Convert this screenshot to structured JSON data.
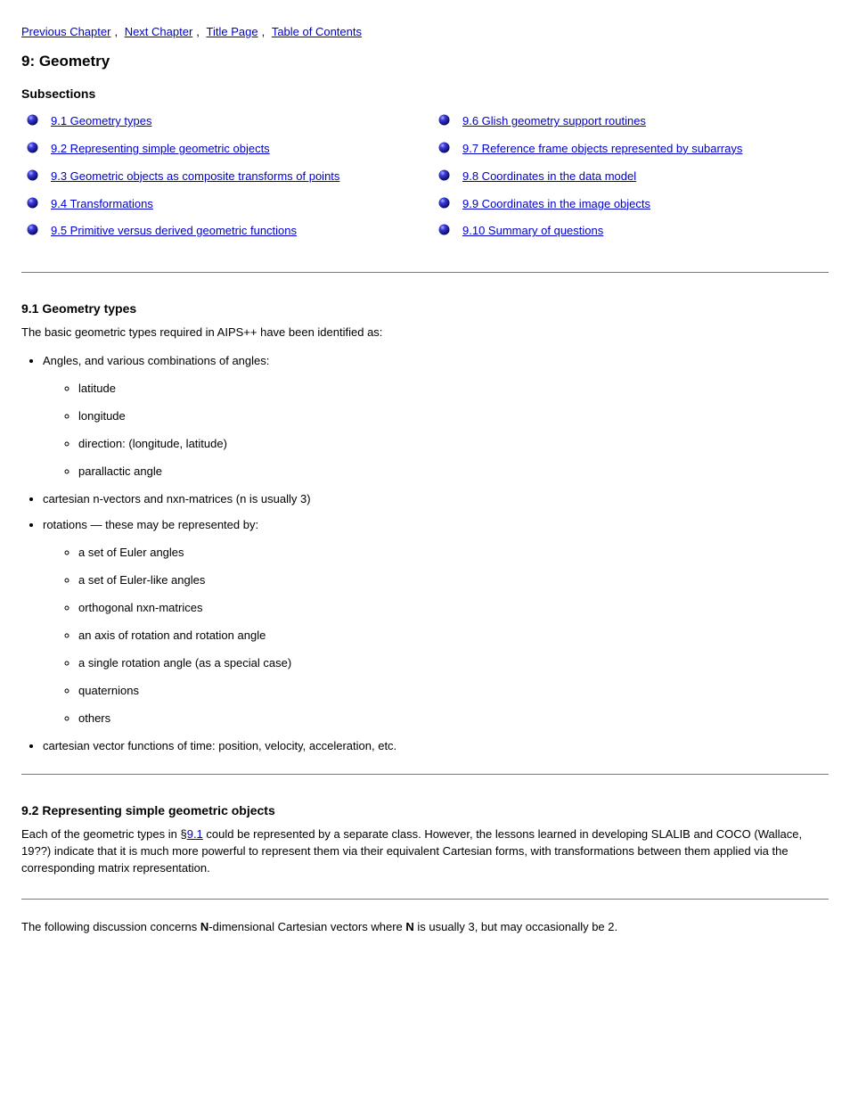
{
  "nav": {
    "prev": "Previous Chapter",
    "sep12": ", ",
    "next": "Next Chapter",
    "sep23": ", ",
    "title": "Title Page",
    "sep34": ", ",
    "toc": "Table of Contents"
  },
  "header": {
    "page_title": "9: Geometry",
    "subsections_label": "Subsections"
  },
  "toc_col1": [
    "9.1 Geometry types",
    "9.2 Representing simple geometric objects",
    "9.3 Geometric objects as composite transforms of points",
    "9.4 Transformations",
    "9.5 Primitive versus derived geometric functions"
  ],
  "toc_col2": [
    "9.6 Glish geometry support routines",
    "9.7 Reference frame objects represented by subarrays",
    "9.8 Coordinates in the data model",
    "9.9 Coordinates in the image objects",
    "9.10 Summary of questions"
  ],
  "sec91": {
    "heading": "9.1 Geometry types",
    "p1": "The basic geometric types required in AIPS++ have been identified as:",
    "bullets": [
      {
        "text": "Angles, and various combinations of angles:",
        "sub": [
          "latitude",
          "longitude",
          "direction: (longitude, latitude)",
          "parallactic angle"
        ]
      },
      {
        "text": "cartesian n-vectors and nxn-matrices (n is usually 3)"
      },
      {
        "text": "rotations — these may be represented by:",
        "sub": [
          "a set of Euler angles",
          "a set of Euler-like angles",
          "orthogonal nxn-matrices",
          "an axis of rotation and rotation angle",
          "a single rotation angle (as a special case)",
          "quaternions",
          "others"
        ]
      },
      {
        "text": "cartesian vector functions of time: position, velocity, acceleration, etc."
      }
    ]
  },
  "sec92": {
    "heading": "9.2 Representing simple geometric objects",
    "p1_prefix": "Each of the geometric types in §",
    "p1_link": "9.1",
    "p1_suffix": " could be represented by a separate class. However, the lessons learned in developing SLALIB and COCO (Wallace, 19??) indicate that it is much more powerful to represent them via their equivalent Cartesian forms, with transformations between them applied via the corresponding matrix representation.",
    "p2_prefix": "The following discussion concerns ",
    "p2_fn": "N",
    "p2_mid": "-dimensional Cartesian vectors where ",
    "p2_fn2": "N",
    "p2_suffix": " is usually 3, but may occasionally be 2."
  }
}
